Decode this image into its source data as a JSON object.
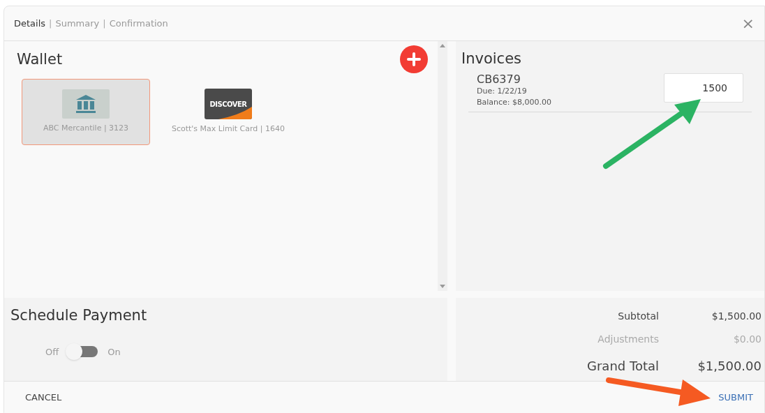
{
  "steps": [
    {
      "label": "Details",
      "selected": true
    },
    {
      "label": "Summary",
      "selected": false
    },
    {
      "label": "Confirmation",
      "selected": false
    }
  ],
  "separator": "|",
  "close": "×",
  "wallet": {
    "title": "Wallet",
    "methods": [
      {
        "kind": "bank",
        "label": "ABC Mercantile | 3123",
        "selected": true
      },
      {
        "kind": "card",
        "logo": "DISCOVER",
        "label": "Scott's Max Limit Card | 1640",
        "selected": false
      }
    ]
  },
  "invoices": {
    "title": "Invoices",
    "items": [
      {
        "number": "CB6379",
        "due": "Due: 1/22/19",
        "balance": "Balance: $8,000.00",
        "amount": "1500"
      }
    ]
  },
  "schedule": {
    "title": "Schedule Payment",
    "off_label": "Off",
    "on_label": "On",
    "on": false
  },
  "totals": [
    {
      "kind": "normal",
      "label": "Subtotal",
      "value": "$1,500.00"
    },
    {
      "kind": "muted",
      "label": "Adjustments",
      "value": "$0.00"
    },
    {
      "kind": "grand",
      "label": "Grand Total",
      "value": "$1,500.00"
    }
  ],
  "footer": {
    "cancel": "CANCEL",
    "submit": "SUBMIT"
  }
}
